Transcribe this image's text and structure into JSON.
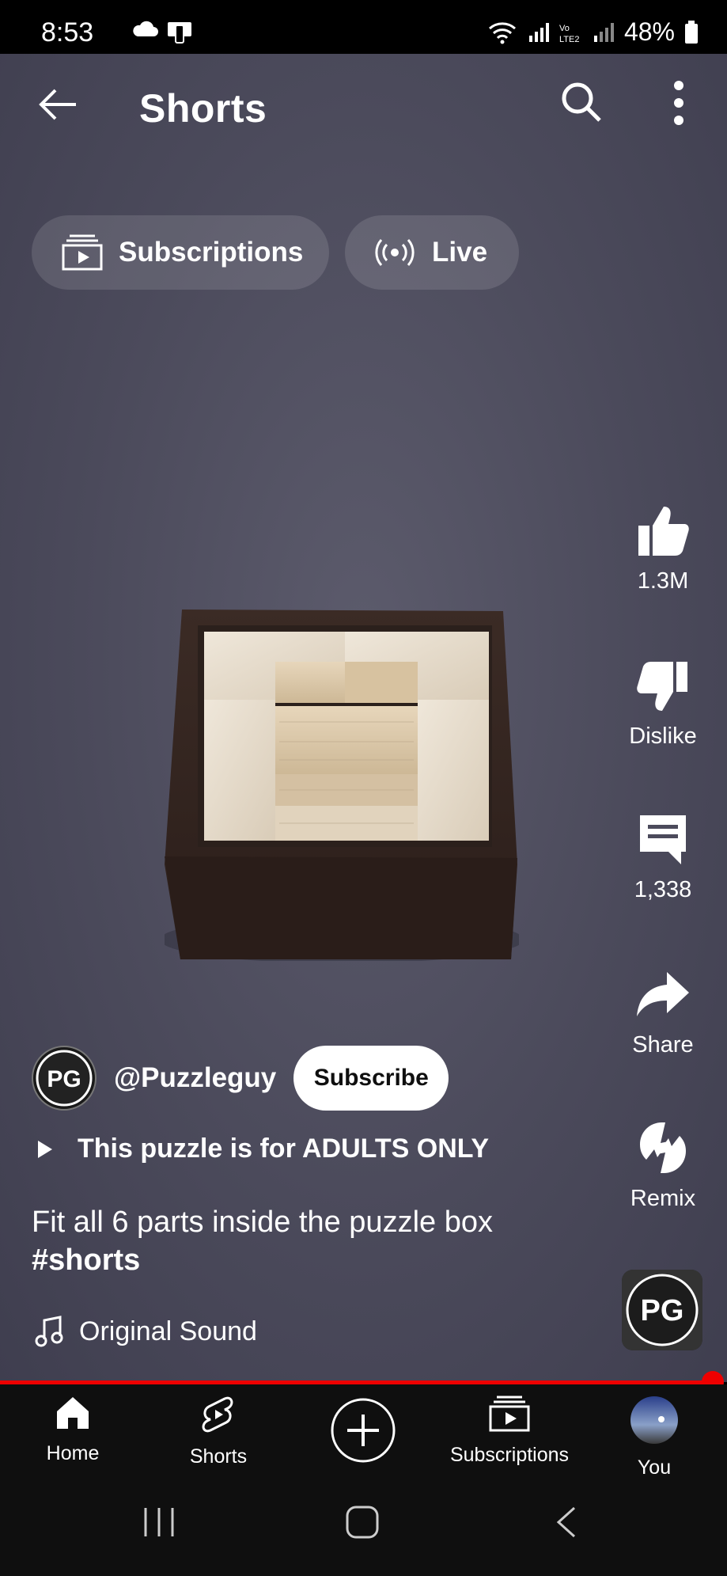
{
  "status_bar": {
    "time": "8:53",
    "battery": "48%"
  },
  "header": {
    "title": "Shorts"
  },
  "chips": [
    {
      "label": "Subscriptions"
    },
    {
      "label": "Live"
    }
  ],
  "actions": {
    "like_count": "1.3M",
    "dislike_label": "Dislike",
    "comment_count": "1,338",
    "share_label": "Share",
    "remix_label": "Remix"
  },
  "video": {
    "channel_handle": "@Puzzleguy",
    "subscribe_label": "Subscribe",
    "playlist_title": "This puzzle is for ADULTS ONLY",
    "description": "Fit all 6 parts inside the puzzle box",
    "hashtag": "#shorts",
    "sound": "Original Sound",
    "progress": 0.98
  },
  "bottom_nav": {
    "items": [
      {
        "label": "Home"
      },
      {
        "label": "Shorts"
      },
      {
        "label": ""
      },
      {
        "label": "Subscriptions"
      },
      {
        "label": "You"
      }
    ]
  },
  "colors": {
    "accent": "#ff0000",
    "background": "#0f0f0f"
  }
}
